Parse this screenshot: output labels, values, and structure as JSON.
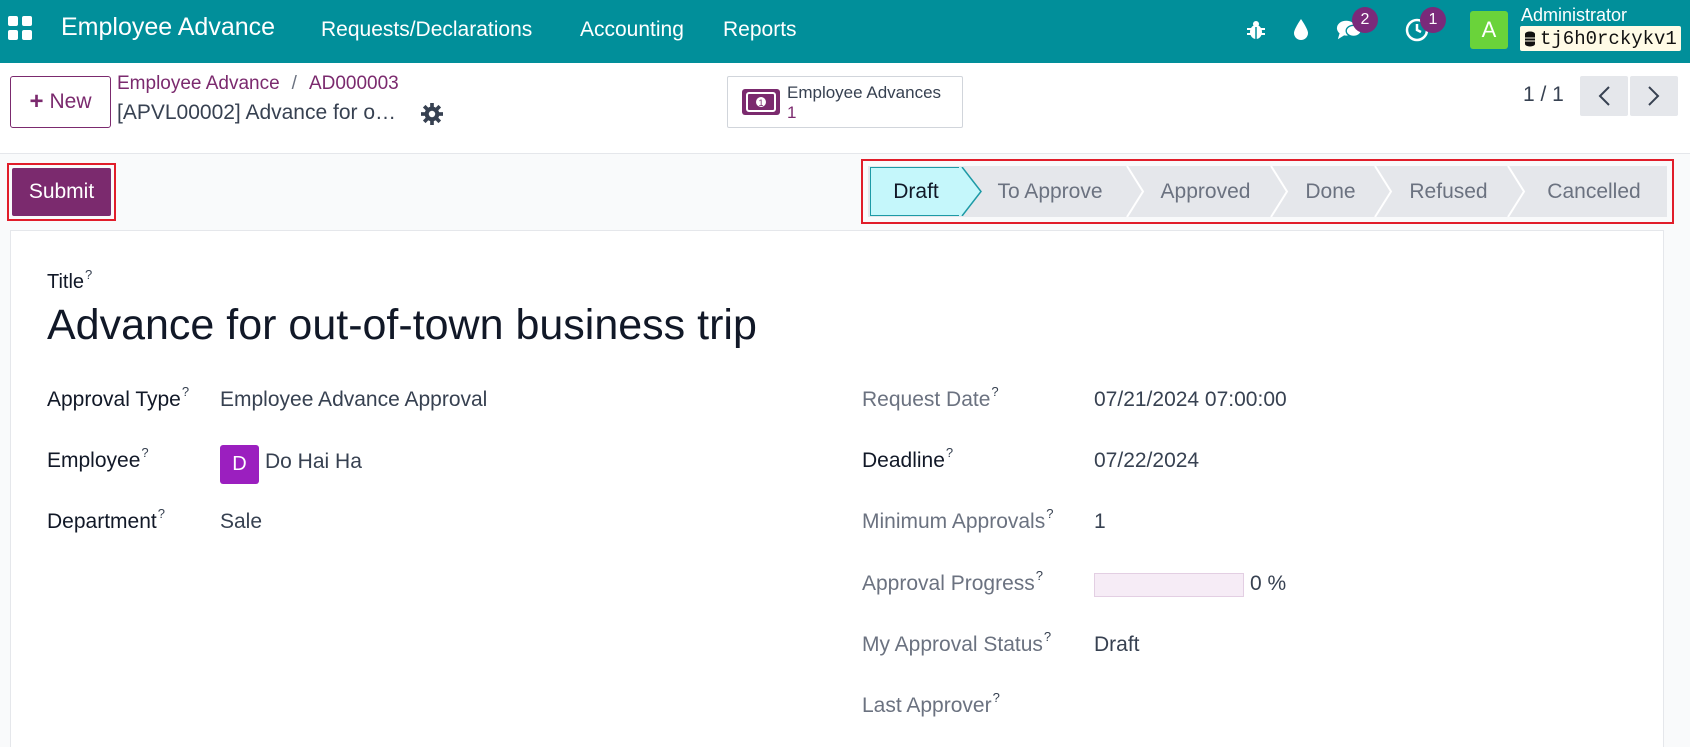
{
  "navbar": {
    "app_title": "Employee Advance",
    "menus": [
      "Requests/Declarations",
      "Accounting",
      "Reports"
    ],
    "messages_count": "2",
    "activities_count": "1",
    "user_initial": "A",
    "user_name": "Administrator",
    "database": "tj6h0rckykv1"
  },
  "control": {
    "new_label": "New",
    "breadcrumb_root": "Employee Advance",
    "breadcrumb_separator": "/",
    "breadcrumb_current": "AD000003",
    "record_title": "[APVL00002] Advance for o…",
    "smart_button_label": "Employee Advances",
    "smart_button_count": "1",
    "pager": "1 / 1"
  },
  "statusbar": {
    "submit_label": "Submit",
    "stages": [
      "Draft",
      "To Approve",
      "Approved",
      "Done",
      "Refused",
      "Cancelled"
    ],
    "active_stage": "Draft"
  },
  "form": {
    "title_label": "Title",
    "title_value": "Advance for out-of-town business trip",
    "approval_type_label": "Approval Type",
    "approval_type_value": "Employee Advance Approval",
    "employee_label": "Employee",
    "employee_initial": "D",
    "employee_value": "Do Hai Ha",
    "department_label": "Department",
    "department_value": "Sale",
    "request_date_label": "Request Date",
    "request_date_value": "07/21/2024 07:00:00",
    "deadline_label": "Deadline",
    "deadline_value": "07/22/2024",
    "min_approvals_label": "Minimum Approvals",
    "min_approvals_value": "1",
    "approval_progress_label": "Approval Progress",
    "approval_progress_value": 0,
    "approval_progress_text": "0 %",
    "my_status_label": "My Approval Status",
    "my_status_value": "Draft",
    "last_approver_label": "Last Approver",
    "tooltip_mark": "?"
  },
  "colors": {
    "navbar": "#018f9a",
    "primary": "#7b2a6e",
    "highlight_border": "#e11d2a",
    "active_stage": "#c5f7fb"
  }
}
